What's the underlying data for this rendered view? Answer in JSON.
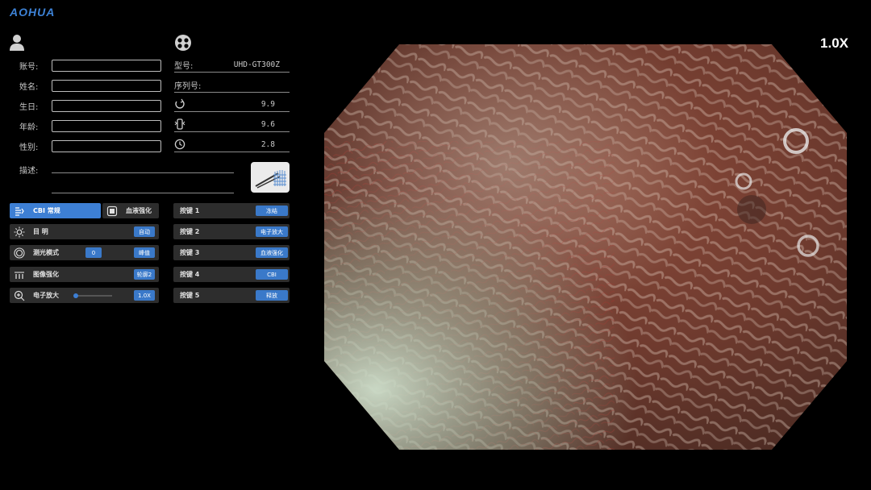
{
  "brand": {
    "logo": "AOHUA",
    "accent": "#3d82d6"
  },
  "zoom": {
    "readout": "1.0X"
  },
  "patient": {
    "icon": "user-icon",
    "fields": [
      {
        "label": "账号:",
        "value": ""
      },
      {
        "label": "姓名:",
        "value": ""
      },
      {
        "label": "生日:",
        "value": ""
      },
      {
        "label": "年龄:",
        "value": ""
      },
      {
        "label": "性别:",
        "value": ""
      }
    ],
    "description_label": "描述:"
  },
  "device": {
    "icon": "endoscope-head-icon",
    "model_label": "型号:",
    "model_value": "UHD-GT300Z",
    "serial_label": "序列号:",
    "serial_value": "",
    "metrics": [
      {
        "icon": "rotate-icon",
        "value": "9.9"
      },
      {
        "icon": "scope-tip-icon",
        "value": "9.6"
      },
      {
        "icon": "clock-icon",
        "value": "2.8"
      }
    ],
    "tool_icon": "instrument-icon"
  },
  "modes": {
    "active_tab": "CBI 常规",
    "inactive_tab": "血液强化"
  },
  "settings": [
    {
      "icon": "brightness-icon",
      "label": "目 明",
      "value": "自动"
    },
    {
      "icon": "metering-icon",
      "label": "测光模式",
      "level": "0",
      "value": "峰值"
    },
    {
      "icon": "image-enhance-icon",
      "label": "图像强化",
      "value": "轮廓2"
    },
    {
      "icon": "zoom-in-icon",
      "label": "电子放大",
      "value": "1.0X",
      "slider_fraction": 0.05
    }
  ],
  "buttons": [
    {
      "label": "按键 1",
      "value": "冻结"
    },
    {
      "label": "按键 2",
      "value": "电子放大"
    },
    {
      "label": "按键 3",
      "value": "血液强化"
    },
    {
      "label": "按键 4",
      "value": "CBI"
    },
    {
      "label": "按键 5",
      "value": "释放"
    }
  ]
}
